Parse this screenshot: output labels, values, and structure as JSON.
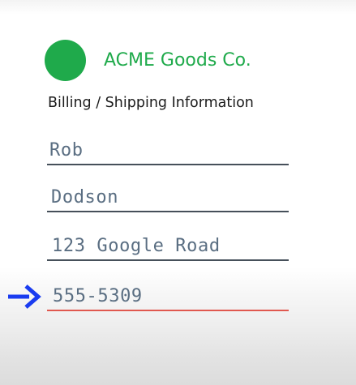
{
  "brand": {
    "name": "ACME Goods Co.",
    "color": "#1faa4b",
    "logo_icon": "green-circle-logo"
  },
  "form": {
    "title": "Billing / Shipping Information",
    "fields": [
      {
        "value": "Rob",
        "focused": false
      },
      {
        "value": "Dodson",
        "focused": false
      },
      {
        "value": "123 Google Road",
        "focused": false
      },
      {
        "value": "555-5309",
        "focused": true
      }
    ],
    "underline_color": "#46505a",
    "focus_underline_color": "#e0584f",
    "text_color": "#5a6e82"
  },
  "annotation": {
    "icon": "right-arrow-icon",
    "color": "#1a3cf0"
  }
}
